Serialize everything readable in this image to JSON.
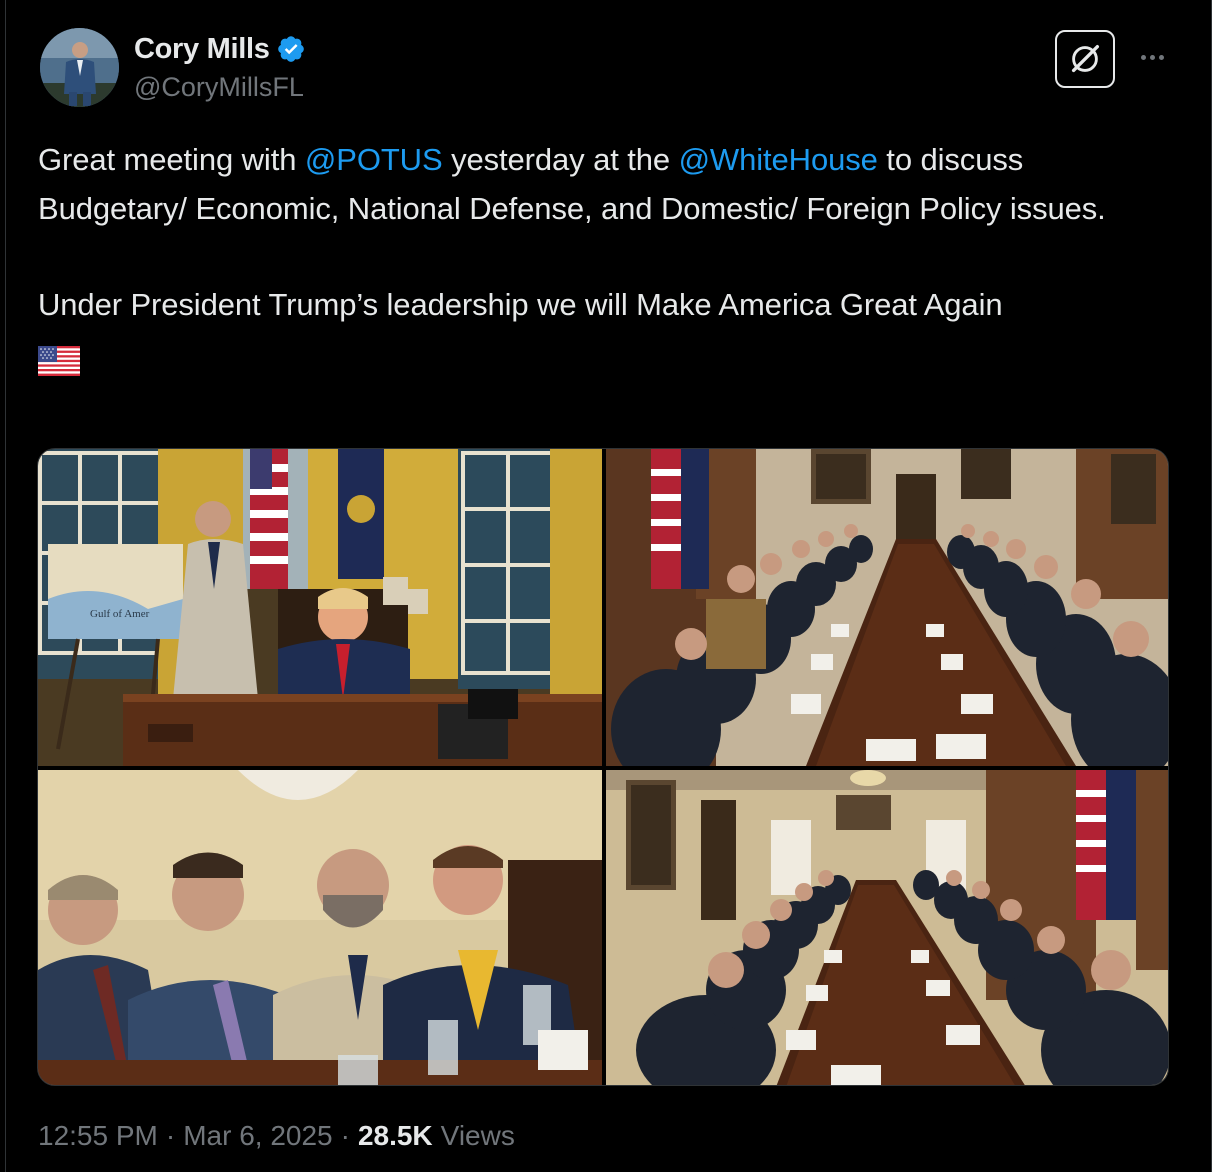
{
  "author": {
    "display_name": "Cory Mills",
    "handle": "@CoryMillsFL",
    "verified": true,
    "verified_color": "#1d9bf0"
  },
  "tweet": {
    "line1_a": "Great meeting with ",
    "mention_potus": "@POTUS",
    "line1_b": " yesterday at the ",
    "mention_whitehouse": "@WhiteHouse",
    "line1_c": " to discuss Budgetary/ Economic, National Defense, and Domestic/ Foreign Policy issues.",
    "line2": "Under President Trump’s leadership we will Make America Great Again",
    "emoji": "us-flag-emoji"
  },
  "media": {
    "count": 4,
    "photos": [
      "oval-office-photo",
      "cabinet-room-photo-1",
      "attendees-closeup-photo",
      "cabinet-room-photo-2"
    ],
    "map_label": "Gulf of Amer"
  },
  "meta": {
    "time": "12:55 PM",
    "separator": "·",
    "date": "Mar 6, 2025",
    "views_count": "28.5K",
    "views_label": "Views"
  },
  "colors": {
    "background": "#000000",
    "text": "#e7e9ea",
    "secondary": "#71767b",
    "link": "#1d9bf0"
  }
}
